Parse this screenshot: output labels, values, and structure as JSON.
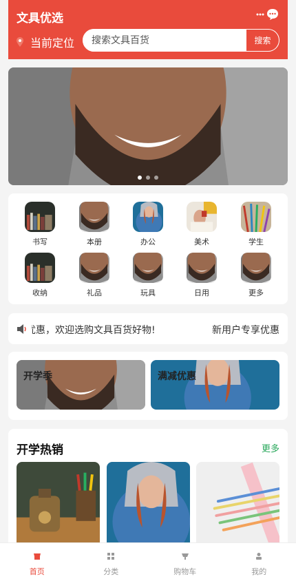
{
  "app": {
    "title": "文具优选"
  },
  "header": {
    "location_label": "当前定位",
    "search": {
      "placeholder": "搜索文具百货",
      "button_label": "搜索"
    }
  },
  "banner": {
    "dot_count": 3,
    "active_index": 0
  },
  "categories": [
    {
      "label": "书写",
      "icon": "books-photo"
    },
    {
      "label": "本册",
      "icon": "man-photo"
    },
    {
      "label": "办公",
      "icon": "woman-hoodie-photo"
    },
    {
      "label": "美术",
      "icon": "art-photo"
    },
    {
      "label": "学生",
      "icon": "pencils-photo"
    },
    {
      "label": "收纳",
      "icon": "books-photo"
    },
    {
      "label": "礼品",
      "icon": "man-photo"
    },
    {
      "label": "玩具",
      "icon": "man-photo"
    },
    {
      "label": "日用",
      "icon": "man-photo"
    },
    {
      "label": "更多",
      "icon": "man-photo"
    }
  ],
  "notice": {
    "text": "享优惠，欢迎选购文具百货好物!",
    "right_text": "新用户专享优惠"
  },
  "promos": [
    {
      "label": "开学季"
    },
    {
      "label": "满减优惠"
    }
  ],
  "hot": {
    "title": "开学热销",
    "more_label": "更多"
  },
  "tabbar": [
    {
      "label": "首页",
      "active": true
    },
    {
      "label": "分类",
      "active": false
    },
    {
      "label": "购物车",
      "active": false
    },
    {
      "label": "我的",
      "active": false
    }
  ],
  "colors": {
    "brand": "#e94b3c",
    "more_link": "#27a75a",
    "tab_inactive": "#999999"
  }
}
